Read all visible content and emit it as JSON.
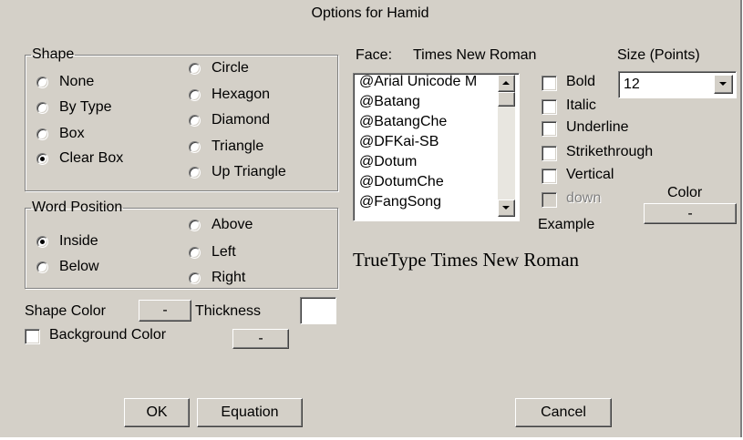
{
  "dialog": {
    "title": "Options for Hamid"
  },
  "shape": {
    "legend": "Shape",
    "options": [
      "None",
      "By Type",
      "Box",
      "Clear Box",
      "Circle",
      "Hexagon",
      "Diamond",
      "Triangle",
      "Up Triangle"
    ],
    "selected": "Clear Box"
  },
  "word_position": {
    "legend": "Word Position",
    "options": [
      "Inside",
      "Below",
      "Above",
      "Left",
      "Right"
    ],
    "selected": "Inside"
  },
  "shape_color": {
    "label": "Shape Color",
    "button": "-"
  },
  "thickness": {
    "label": "Thickness",
    "value": ""
  },
  "background_color": {
    "label": "Background Color",
    "button": "-",
    "checked": false
  },
  "face": {
    "label": "Face:",
    "value": "Times New Roman",
    "list": [
      "@Arial Unicode M",
      "@Batang",
      "@BatangChe",
      "@DFKai-SB",
      "@Dotum",
      "@DotumChe",
      "@FangSong"
    ]
  },
  "size": {
    "label": "Size (Points)",
    "value": "12"
  },
  "styles": {
    "bold": "Bold",
    "italic": "Italic",
    "underline": "Underline",
    "strikethrough": "Strikethrough",
    "vertical": "Vertical",
    "down": "down"
  },
  "color": {
    "label": "Color",
    "button": "-"
  },
  "example": {
    "label": "Example",
    "text": "TrueType Times New Roman"
  },
  "buttons": {
    "ok": "OK",
    "equation": "Equation",
    "cancel": "Cancel"
  },
  "colors": {
    "face": "#d4d0c8",
    "shadow": "#808080",
    "highlight": "#ffffff"
  }
}
